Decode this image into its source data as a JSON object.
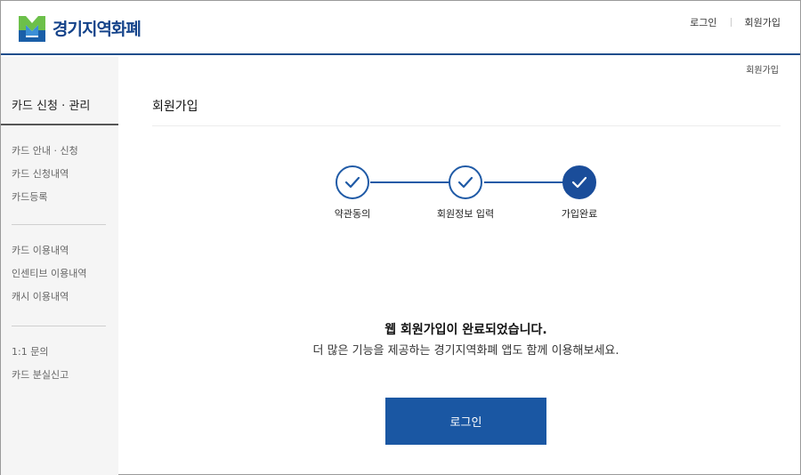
{
  "header": {
    "logo_text": "경기지역화폐",
    "nav": {
      "login": "로그인",
      "signup": "회원가입"
    }
  },
  "sidebar": {
    "title": "카드 신청 · 관리",
    "groups": [
      [
        "카드 안내 · 신청",
        "카드 신청내역",
        "카드등록"
      ],
      [
        "카드 이용내역",
        "인센티브 이용내역",
        "캐시 이용내역"
      ],
      [
        "1:1 문의",
        "카드 분실신고"
      ]
    ]
  },
  "breadcrumb": "회원가입",
  "page_title": "회원가입",
  "steps": [
    {
      "label": "약관동의",
      "status": "done"
    },
    {
      "label": "회원정보 입력",
      "status": "done"
    },
    {
      "label": "가입완료",
      "status": "current"
    }
  ],
  "message": {
    "main": "웹 회원가입이 완료되었습니다.",
    "sub": "더 많은 기능을 제공하는 경기지역화폐 앱도 함께 이용해보세요."
  },
  "login_button": "로그인",
  "colors": {
    "primary": "#1a57a3",
    "brand": "#14438a",
    "accent_green": "#6cc04a"
  }
}
